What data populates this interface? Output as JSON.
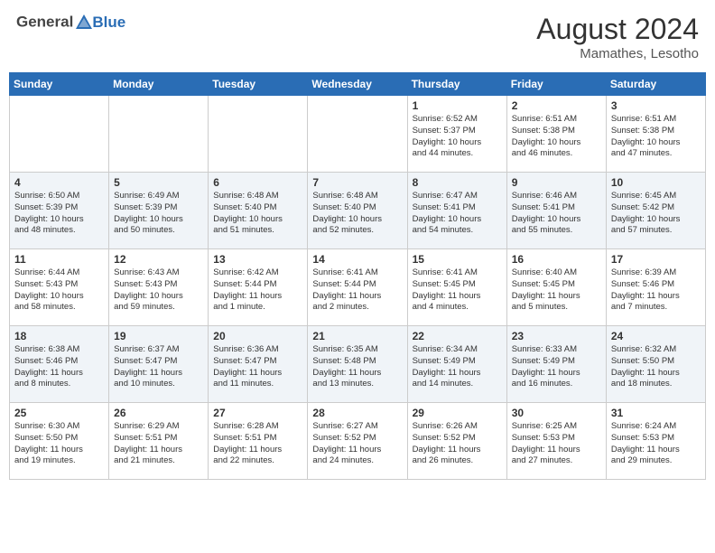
{
  "header": {
    "logo_line1": "General",
    "logo_line2": "Blue",
    "month_year": "August 2024",
    "location": "Mamathes, Lesotho"
  },
  "days_of_week": [
    "Sunday",
    "Monday",
    "Tuesday",
    "Wednesday",
    "Thursday",
    "Friday",
    "Saturday"
  ],
  "weeks": [
    [
      {
        "num": "",
        "info": ""
      },
      {
        "num": "",
        "info": ""
      },
      {
        "num": "",
        "info": ""
      },
      {
        "num": "",
        "info": ""
      },
      {
        "num": "1",
        "info": "Sunrise: 6:52 AM\nSunset: 5:37 PM\nDaylight: 10 hours\nand 44 minutes."
      },
      {
        "num": "2",
        "info": "Sunrise: 6:51 AM\nSunset: 5:38 PM\nDaylight: 10 hours\nand 46 minutes."
      },
      {
        "num": "3",
        "info": "Sunrise: 6:51 AM\nSunset: 5:38 PM\nDaylight: 10 hours\nand 47 minutes."
      }
    ],
    [
      {
        "num": "4",
        "info": "Sunrise: 6:50 AM\nSunset: 5:39 PM\nDaylight: 10 hours\nand 48 minutes."
      },
      {
        "num": "5",
        "info": "Sunrise: 6:49 AM\nSunset: 5:39 PM\nDaylight: 10 hours\nand 50 minutes."
      },
      {
        "num": "6",
        "info": "Sunrise: 6:48 AM\nSunset: 5:40 PM\nDaylight: 10 hours\nand 51 minutes."
      },
      {
        "num": "7",
        "info": "Sunrise: 6:48 AM\nSunset: 5:40 PM\nDaylight: 10 hours\nand 52 minutes."
      },
      {
        "num": "8",
        "info": "Sunrise: 6:47 AM\nSunset: 5:41 PM\nDaylight: 10 hours\nand 54 minutes."
      },
      {
        "num": "9",
        "info": "Sunrise: 6:46 AM\nSunset: 5:41 PM\nDaylight: 10 hours\nand 55 minutes."
      },
      {
        "num": "10",
        "info": "Sunrise: 6:45 AM\nSunset: 5:42 PM\nDaylight: 10 hours\nand 57 minutes."
      }
    ],
    [
      {
        "num": "11",
        "info": "Sunrise: 6:44 AM\nSunset: 5:43 PM\nDaylight: 10 hours\nand 58 minutes."
      },
      {
        "num": "12",
        "info": "Sunrise: 6:43 AM\nSunset: 5:43 PM\nDaylight: 10 hours\nand 59 minutes."
      },
      {
        "num": "13",
        "info": "Sunrise: 6:42 AM\nSunset: 5:44 PM\nDaylight: 11 hours\nand 1 minute."
      },
      {
        "num": "14",
        "info": "Sunrise: 6:41 AM\nSunset: 5:44 PM\nDaylight: 11 hours\nand 2 minutes."
      },
      {
        "num": "15",
        "info": "Sunrise: 6:41 AM\nSunset: 5:45 PM\nDaylight: 11 hours\nand 4 minutes."
      },
      {
        "num": "16",
        "info": "Sunrise: 6:40 AM\nSunset: 5:45 PM\nDaylight: 11 hours\nand 5 minutes."
      },
      {
        "num": "17",
        "info": "Sunrise: 6:39 AM\nSunset: 5:46 PM\nDaylight: 11 hours\nand 7 minutes."
      }
    ],
    [
      {
        "num": "18",
        "info": "Sunrise: 6:38 AM\nSunset: 5:46 PM\nDaylight: 11 hours\nand 8 minutes."
      },
      {
        "num": "19",
        "info": "Sunrise: 6:37 AM\nSunset: 5:47 PM\nDaylight: 11 hours\nand 10 minutes."
      },
      {
        "num": "20",
        "info": "Sunrise: 6:36 AM\nSunset: 5:47 PM\nDaylight: 11 hours\nand 11 minutes."
      },
      {
        "num": "21",
        "info": "Sunrise: 6:35 AM\nSunset: 5:48 PM\nDaylight: 11 hours\nand 13 minutes."
      },
      {
        "num": "22",
        "info": "Sunrise: 6:34 AM\nSunset: 5:49 PM\nDaylight: 11 hours\nand 14 minutes."
      },
      {
        "num": "23",
        "info": "Sunrise: 6:33 AM\nSunset: 5:49 PM\nDaylight: 11 hours\nand 16 minutes."
      },
      {
        "num": "24",
        "info": "Sunrise: 6:32 AM\nSunset: 5:50 PM\nDaylight: 11 hours\nand 18 minutes."
      }
    ],
    [
      {
        "num": "25",
        "info": "Sunrise: 6:30 AM\nSunset: 5:50 PM\nDaylight: 11 hours\nand 19 minutes."
      },
      {
        "num": "26",
        "info": "Sunrise: 6:29 AM\nSunset: 5:51 PM\nDaylight: 11 hours\nand 21 minutes."
      },
      {
        "num": "27",
        "info": "Sunrise: 6:28 AM\nSunset: 5:51 PM\nDaylight: 11 hours\nand 22 minutes."
      },
      {
        "num": "28",
        "info": "Sunrise: 6:27 AM\nSunset: 5:52 PM\nDaylight: 11 hours\nand 24 minutes."
      },
      {
        "num": "29",
        "info": "Sunrise: 6:26 AM\nSunset: 5:52 PM\nDaylight: 11 hours\nand 26 minutes."
      },
      {
        "num": "30",
        "info": "Sunrise: 6:25 AM\nSunset: 5:53 PM\nDaylight: 11 hours\nand 27 minutes."
      },
      {
        "num": "31",
        "info": "Sunrise: 6:24 AM\nSunset: 5:53 PM\nDaylight: 11 hours\nand 29 minutes."
      }
    ]
  ]
}
